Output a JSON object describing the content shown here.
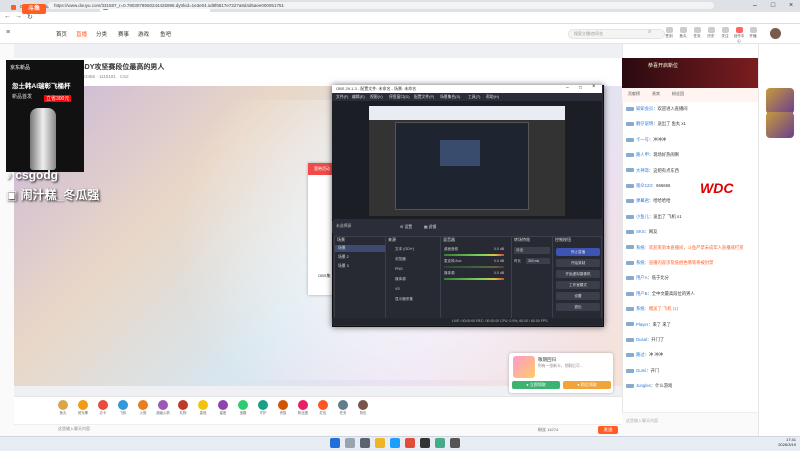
{
  "browser": {
    "tabs": [
      {
        "label": "CS2篮球_CounterStrike篮球_CS2直…",
        "active": false,
        "color": "#ff5d23"
      },
      {
        "label": "BLAST德州杯总决赛_赛事报名直播",
        "active": true,
        "color": "#ff5d23"
      }
    ],
    "url": "https://www.douyu.com/331587_r=0.7803078950244425988.dytrkid=1e3e04.sd8f6817e7227a8d4d5aee000051751"
  },
  "site": {
    "logo": "斗鱼",
    "nav": [
      "首页",
      "直播",
      "分类",
      "赛事",
      "游戏",
      "鱼吧"
    ],
    "nav_active": 1,
    "search_placeholder": "搜索主播/房间名",
    "header_icons": [
      "签到",
      "鱼丸",
      "任务",
      "历史",
      "关注",
      "创作中心",
      "开播",
      "消息",
      "客服"
    ]
  },
  "room": {
    "title": "SDY攻坚赛段位最高的男人",
    "meta": "123456 · 1115181 · CS2"
  },
  "overlay": {
    "jd_label": "京东新品",
    "ad_title": "忽士韩AI瑞彰飞桶杯",
    "ad_sub": "新品首发",
    "ad_price": "立省300元",
    "tiktok": "csgodg",
    "bili": "闹汁糕_冬瓜强"
  },
  "promo_popup": {
    "header": "宽带活动",
    "side_text": "OBS集"
  },
  "obs": {
    "title": "OBS 29.1.3 - 配置文件: 未命名 - 场景: 未命名",
    "menu": [
      "文件(F)",
      "编辑(E)",
      "视图(V)",
      "停靠窗口(D)",
      "配置文件(P)",
      "场景集合(S)",
      "工具(T)",
      "帮助(H)"
    ],
    "source_bar": [
      "未选择源",
      "⚙ 设置",
      "▦ 滤镜"
    ],
    "docks": {
      "scenes": {
        "title": "场景",
        "items": [
          "场景",
          "场景 2",
          "场景 3"
        ]
      },
      "sources": {
        "title": "来源",
        "items": [
          "文本 (GDI+)",
          "浏览器",
          "PNG",
          "媒体源",
          "VS",
          "显示器采集"
        ]
      },
      "mixer": {
        "title": "混音器",
        "channels": [
          {
            "name": "桌面音频",
            "db": "0.0 dB",
            "level": 0.72
          },
          {
            "name": "麦克风/Aux",
            "db": "0.0 dB",
            "level": 0.0
          },
          {
            "name": "媒体源",
            "db": "0.0 dB",
            "level": 0.55
          }
        ]
      },
      "transitions": {
        "title": "转场特效",
        "type": "淡出",
        "duration_label": "时长",
        "duration": "300 ms"
      },
      "controls": {
        "title": "控制按钮",
        "buttons": [
          "停止直播",
          "开始录制",
          "开始虚拟摄像机",
          "工作室模式",
          "设置",
          "退出"
        ]
      }
    },
    "status": "LIVE: 00:00:00   REC: 00:00:00   CPU: 0.9%, 60.00 / 60.00 FPS"
  },
  "notify_card": {
    "title": "敬期回归",
    "sub": "你有一张新卡，领取后可...",
    "btn_primary": "● 立即领取",
    "btn_secondary": "● 稍后领取"
  },
  "chat": {
    "banner": "恭喜开启新位",
    "rank_tabs": [
      "贡献榜",
      "贵宾",
      "粉丝团"
    ],
    "messages": [
      {
        "user": "知知会员",
        "text": "欢迎进入直播间",
        "sys": false
      },
      {
        "user": "靓仔说明",
        "text": "送出了 鱼丸 x1",
        "sys": false
      },
      {
        "user": "卡一号",
        "text": "冲冲冲",
        "sys": false
      },
      {
        "user": "路人甲",
        "text": "现场好热闹啊",
        "sys": false
      },
      {
        "user": "大神哥",
        "text": "这把有点东西",
        "sys": false
      },
      {
        "user": "观众123",
        "text": "666666",
        "sys": false
      },
      {
        "user": "弹幕君",
        "text": "哈哈哈哈",
        "sys": false
      },
      {
        "user": "小鱼儿",
        "text": "送出了 飞机 x1",
        "sys": false
      },
      {
        "user": "SKS",
        "text": "网友",
        "sys": false
      },
      {
        "user": "系统",
        "text": "欢迎来到本直播间，斗鱼严禁未成年人直播或打赏",
        "sys": true
      },
      {
        "user": "系统",
        "text": "直播内容涉及低俗色情等将被封禁",
        "sys": true
      },
      {
        "user": "用户A",
        "text": "低于比分",
        "sys": false
      },
      {
        "user": "用户B",
        "text": "全中文最高段位的男人",
        "sys": false
      },
      {
        "user": "系统",
        "text": "赠送了 飞机 (1)",
        "sys": true
      },
      {
        "user": "Player",
        "text": "来了 来了",
        "sys": false
      },
      {
        "user": "Dusal",
        "text": "开门了",
        "sys": false
      },
      {
        "user": "路过",
        "text": "冲 冲冲",
        "sys": false
      },
      {
        "user": "Gumi",
        "text": "开门",
        "sys": false
      },
      {
        "user": "Jungles",
        "text": "什么游戏",
        "sys": false
      }
    ],
    "input_placeholder": "这里输入聊天内容",
    "brand": "WDC"
  },
  "gift_bar": {
    "gifts": [
      "鱼丸",
      "荧光棒",
      "办卡",
      "飞机",
      "火箭",
      "超级火箭",
      "礼物",
      "皇冠",
      "星座",
      "宝箱",
      "守护",
      "贵族",
      "粉丝团",
      "红包",
      "任务",
      "背包"
    ],
    "send": "发送",
    "count": "粉丝 14274"
  },
  "clock": {
    "time": "17:41",
    "date": "2026/3/19"
  }
}
